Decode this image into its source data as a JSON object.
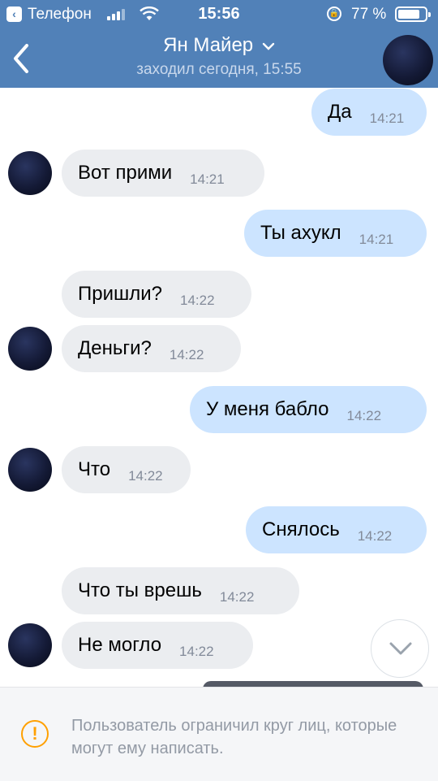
{
  "status_bar": {
    "carrier": "Телефон",
    "time": "15:56",
    "battery_pct": "77 %"
  },
  "header": {
    "name": "Ян Майер",
    "subtitle": "заходил сегодня, 15:55",
    "bg_color": "#5181b8"
  },
  "messages": [
    {
      "dir": "out",
      "text": "Да",
      "time": "14:21"
    },
    {
      "dir": "in",
      "text": "Вот прими",
      "time": "14:21",
      "avatar": true
    },
    {
      "dir": "out",
      "text": "Ты ахукл",
      "time": "14:21"
    },
    {
      "dir": "in",
      "text": "Пришли?",
      "time": "14:22",
      "avatar": false
    },
    {
      "dir": "in",
      "text": "Деньги?",
      "time": "14:22",
      "avatar": true
    },
    {
      "dir": "out",
      "text": "У меня бабло",
      "time": "14:22"
    },
    {
      "dir": "in",
      "text": "Что",
      "time": "14:22",
      "avatar": true
    },
    {
      "dir": "out",
      "text": "Снялось",
      "time": "14:22"
    },
    {
      "dir": "in",
      "text": "Что ты врешь",
      "time": "14:22",
      "avatar": false
    },
    {
      "dir": "in",
      "text": "Не могло",
      "time": "14:22",
      "avatar": true
    }
  ],
  "footer": {
    "notice": "Пользователь ограничил круг лиц, которые могут ему написать."
  },
  "colors": {
    "outgoing_bubble": "#cce4ff",
    "incoming_bubble": "#ebedf0",
    "warning": "#ffa000"
  }
}
